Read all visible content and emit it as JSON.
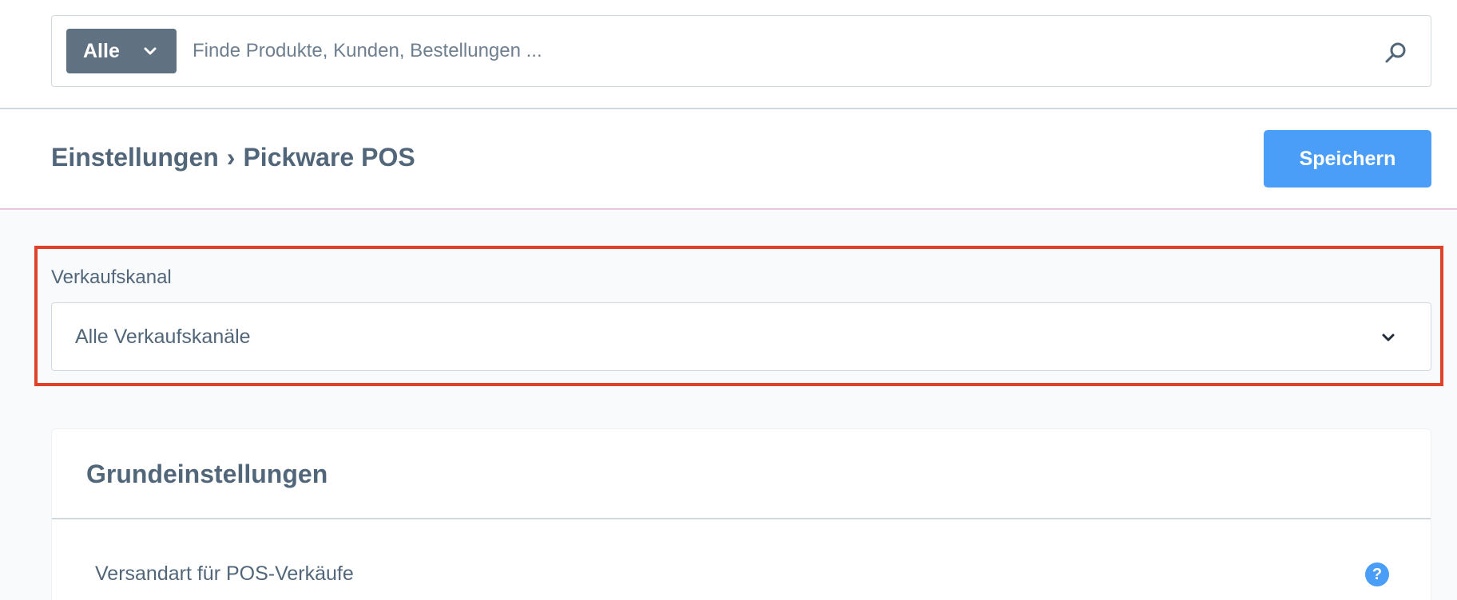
{
  "search": {
    "type_label": "Alle",
    "placeholder": "Finde Produkte, Kunden, Bestellungen ..."
  },
  "header": {
    "breadcrumb_parent": "Einstellungen",
    "breadcrumb_separator": "›",
    "breadcrumb_current": "Pickware POS",
    "save_label": "Speichern"
  },
  "sales_channel": {
    "label": "Verkaufskanal",
    "selected": "Alle Verkaufskanäle"
  },
  "card": {
    "title": "Grundeinstellungen",
    "fields": [
      {
        "label": "Versandart für POS-Verkäufe",
        "help": "?"
      }
    ]
  },
  "colors": {
    "accent": "#4a9ef8",
    "type_button": "#607182",
    "highlight": "#e0412a",
    "text": "#52667a"
  },
  "icons": {
    "type_chevron": "chevron-down-icon",
    "search": "search-icon",
    "select_chevron": "chevron-down-icon",
    "help": "help-icon"
  }
}
